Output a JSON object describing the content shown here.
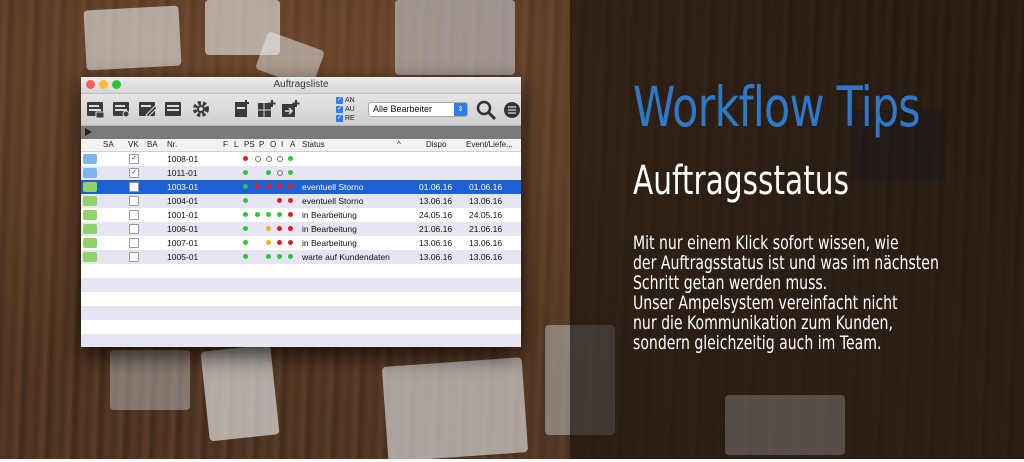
{
  "window": {
    "title": "Auftragsliste",
    "filter_checkboxes": [
      {
        "label": "AN",
        "checked": true
      },
      {
        "label": "AU",
        "checked": true
      },
      {
        "label": "RE",
        "checked": true
      }
    ],
    "editor_select": {
      "value": "Alle Bearbeiter"
    }
  },
  "table": {
    "columns": {
      "sa": "SA",
      "vk": "VK",
      "ba": "BA",
      "nr": "Nr.",
      "f": "F",
      "l": "L",
      "ps": "PS",
      "p": "P",
      "o": "O",
      "i": "I",
      "a": "A",
      "status": "Status",
      "dispo": "Dispo",
      "event": "Event/Liefe..."
    },
    "rows": [
      {
        "nr": "1008-01",
        "status": "",
        "dispo": "",
        "event": "",
        "vk_checked": true,
        "tag": "#7fb6ea",
        "dots": [
          "#e02020",
          "o",
          "o",
          "o",
          "#29c73a"
        ],
        "selected": false
      },
      {
        "nr": "1011-01",
        "status": "",
        "dispo": "",
        "event": "",
        "vk_checked": true,
        "tag": "#7fb6ea",
        "dots": [
          "#29c73a",
          "",
          "#29c73a",
          "o",
          "#29c73a"
        ],
        "selected": false
      },
      {
        "nr": "1003-01",
        "status": "eventuell Storno",
        "dispo": "01.06.16",
        "event": "01.06.16",
        "vk_checked": false,
        "tag": "#8fd36a",
        "dots": [
          "#29c73a",
          "#e02020",
          "#e02020",
          "#e02020",
          "#e02020"
        ],
        "selected": true
      },
      {
        "nr": "1004-01",
        "status": "eventuell Storno",
        "dispo": "13.06.16",
        "event": "13.06.16",
        "vk_checked": false,
        "tag": "#8fd36a",
        "dots": [
          "#29c73a",
          "",
          "",
          "#e02020",
          "#e02020"
        ],
        "selected": false
      },
      {
        "nr": "1001-01",
        "status": "in Bearbeitung",
        "dispo": "24.05.16",
        "event": "24.05.16",
        "vk_checked": false,
        "tag": "#8fd36a",
        "dots": [
          "#29c73a",
          "#29c73a",
          "#29c73a",
          "#29c73a",
          "#e02020"
        ],
        "selected": false
      },
      {
        "nr": "1006-01",
        "status": "in Bearbeitung",
        "dispo": "21.06.16",
        "event": "21.06.16",
        "vk_checked": false,
        "tag": "#8fd36a",
        "dots": [
          "#29c73a",
          "",
          "#f0b020",
          "#e02020",
          "#e02020"
        ],
        "selected": false
      },
      {
        "nr": "1007-01",
        "status": "in Bearbeitung",
        "dispo": "13.06.16",
        "event": "13.06.16",
        "vk_checked": false,
        "tag": "#8fd36a",
        "dots": [
          "#29c73a",
          "",
          "#f0b020",
          "#e02020",
          "#e02020"
        ],
        "selected": false
      },
      {
        "nr": "1005-01",
        "status": "warte auf Kundendaten",
        "dispo": "13.06.16",
        "event": "13.06.16",
        "vk_checked": false,
        "tag": "#8fd36a",
        "dots": [
          "#29c73a",
          "",
          "#29c73a",
          "#29c73a",
          "#29c73a"
        ],
        "selected": false
      }
    ]
  },
  "promo": {
    "headline": "Workflow Tips",
    "subhead": "Auftragsstatus",
    "lines": [
      "Mit nur einem Klick sofort wissen, wie",
      "der Auftragsstatus ist und was im nächsten",
      "Schritt getan werden muss.",
      "Unser Ampelsystem vereinfacht nicht",
      "nur die Kommunikation zum Kunden,",
      "sondern gleichzeitig auch im Team."
    ]
  },
  "colors": {
    "accent": "#2f78c8",
    "selection": "#1c5fd6",
    "red": "#e02020",
    "green": "#29c73a",
    "amber": "#f0b020"
  }
}
